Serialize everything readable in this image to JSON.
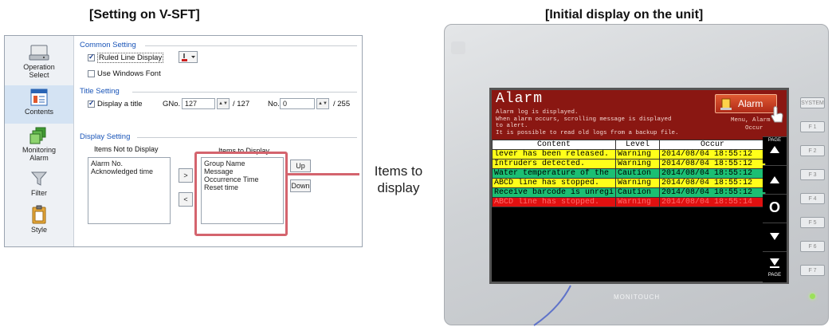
{
  "headings": {
    "left": "[Setting on V-SFT]",
    "right": "[Initial display on the unit]"
  },
  "sidebar": {
    "items": [
      {
        "label": "Operation\nSelect",
        "icon": "operation-select-icon"
      },
      {
        "label": "Contents",
        "icon": "contents-icon"
      },
      {
        "label": "Monitoring\nAlarm",
        "icon": "monitoring-alarm-icon"
      },
      {
        "label": "Filter",
        "icon": "filter-icon"
      },
      {
        "label": "Style",
        "icon": "style-icon"
      }
    ]
  },
  "common_setting": {
    "title": "Common Setting",
    "ruled_line": "Ruled Line Display",
    "windows_font": "Use Windows Font"
  },
  "title_setting": {
    "title": "Title Setting",
    "display_title": "Display a title",
    "gno_label": "GNo.",
    "gno_value": "127",
    "gno_max": "/ 127",
    "no_label": "No.",
    "no_value": "0",
    "no_max": "/ 255"
  },
  "display_setting": {
    "title": "Display Setting",
    "not_display_header": "Items Not to Display",
    "display_header": "Items to Display",
    "not_display_items": [
      "Alarm No.",
      "Acknowledged time"
    ],
    "display_items": [
      "Group Name",
      "Message",
      "Occurrence Time",
      "Reset time"
    ],
    "move_right": ">",
    "move_left": "<",
    "up": "Up",
    "down": "Down"
  },
  "callout": {
    "text": "Items to\ndisplay",
    "color": "#d4646e"
  },
  "screen": {
    "title": "Alarm",
    "desc": [
      "Alarm log is displayed.",
      "When alarm occurs, scrolling message is displayed",
      "to alert.",
      "It is possible to read old logs from a backup file."
    ],
    "alarm_button": "Alarm",
    "menu_note": "Menu, Alarm",
    "menu_note2": "Occur",
    "columns": [
      "Content",
      "Level",
      "Occur"
    ],
    "rows": [
      {
        "content": " lever has been released.",
        "level": "Warning",
        "occur": "2014/08/04 18:55:12",
        "bg": "#ffff1a",
        "fg": "#000000"
      },
      {
        "content": "Intruders detected.",
        "level": "Warning",
        "occur": "2014/08/04 18:55:12",
        "bg": "#ffff1a",
        "fg": "#000000"
      },
      {
        "content": "Water temperature of the",
        "level": "Caution",
        "occur": "2014/08/04 18:55:12",
        "bg": "#1bbf73",
        "fg": "#000000"
      },
      {
        "content": "ABCD line has stopped.",
        "level": "Warning",
        "occur": "2014/08/04 18:55:12",
        "bg": "#ffff1a",
        "fg": "#000000"
      },
      {
        "content": "Receive barcode is unregi",
        "level": "Caution",
        "occur": "2014/08/04 18:55:12",
        "bg": "#1bbf73",
        "fg": "#000000"
      },
      {
        "content": "ABCD line has stopped.",
        "level": "Warning",
        "occur": "2014/08/04 18:55:14",
        "bg": "#e01010",
        "fg": "#ff6d6d"
      }
    ],
    "nav": {
      "page_label": "PAGE",
      "reset": "O"
    }
  },
  "device": {
    "brand": "MONITOUCH",
    "fkeys": [
      "SYSTEM",
      "F 1",
      "F 2",
      "F 3",
      "F 4",
      "F 5",
      "F 6",
      "F 7"
    ]
  }
}
